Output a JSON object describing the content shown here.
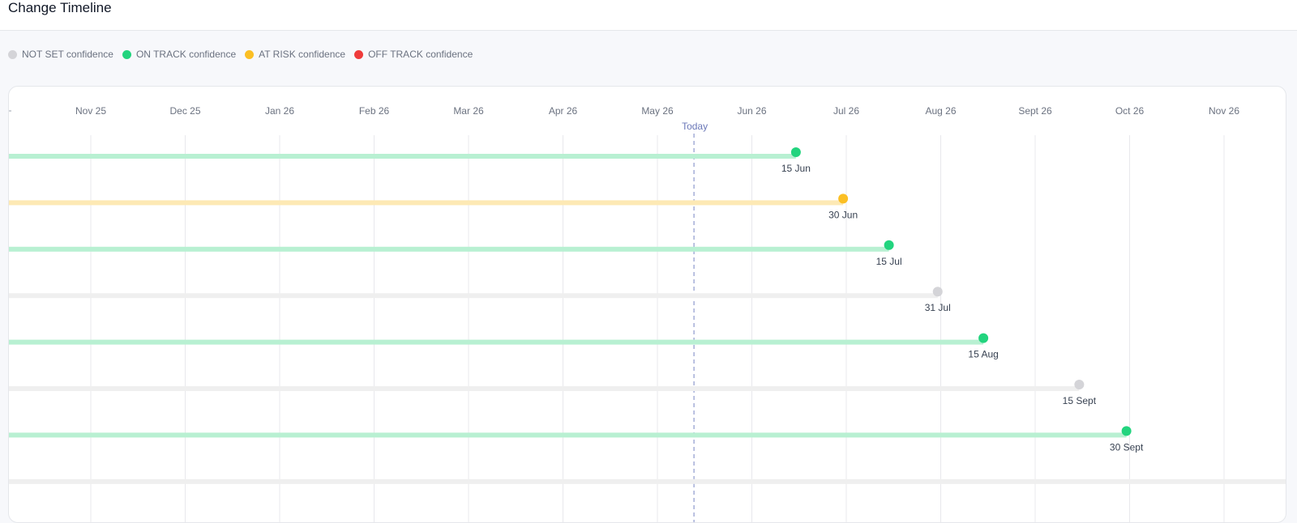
{
  "header": {
    "title": "Change Timeline"
  },
  "legend": [
    {
      "label": "NOT SET confidence",
      "color": "#d4d4d8",
      "icon": "dot-icon-not-set"
    },
    {
      "label": "ON TRACK confidence",
      "color": "#22d47e",
      "icon": "dot-icon-on-track"
    },
    {
      "label": "AT RISK confidence",
      "color": "#fbbf24",
      "icon": "dot-icon-at-risk"
    },
    {
      "label": "OFF TRACK confidence",
      "color": "#ef3b3b",
      "icon": "dot-icon-off-track"
    }
  ],
  "timeline": {
    "months": [
      "Nov 25",
      "Dec 25",
      "Jan 26",
      "Feb 26",
      "Mar 26",
      "Apr 26",
      "May 26",
      "Jun 26",
      "Jul 26",
      "Aug 26",
      "Sept 26",
      "Oct 26",
      "Nov 26"
    ],
    "today_label": "Today",
    "today_date": "2026-05-13",
    "status_colors": {
      "not_set": {
        "dot": "#d4d4d8",
        "bar": "#efefef"
      },
      "on_track": {
        "dot": "#22d47e",
        "bar": "#b8f0d2"
      },
      "at_risk": {
        "dot": "#fbbf24",
        "bar": "#fde9b4"
      },
      "off_track": {
        "dot": "#ef3b3b",
        "bar": "#fbd0d0"
      }
    },
    "items": [
      {
        "due": "2026-06-15",
        "label": "15 Jun",
        "status": "on_track"
      },
      {
        "due": "2026-06-30",
        "label": "30 Jun",
        "status": "at_risk"
      },
      {
        "due": "2026-07-15",
        "label": "15 Jul",
        "status": "on_track"
      },
      {
        "due": "2026-07-31",
        "label": "31 Jul",
        "status": "not_set"
      },
      {
        "due": "2026-08-15",
        "label": "15 Aug",
        "status": "on_track"
      },
      {
        "due": "2026-09-15",
        "label": "15 Sept",
        "status": "not_set"
      },
      {
        "due": "2026-09-30",
        "label": "30 Sept",
        "status": "on_track"
      },
      {
        "due": "2026-11-30",
        "label": "",
        "status": "not_set"
      }
    ]
  }
}
